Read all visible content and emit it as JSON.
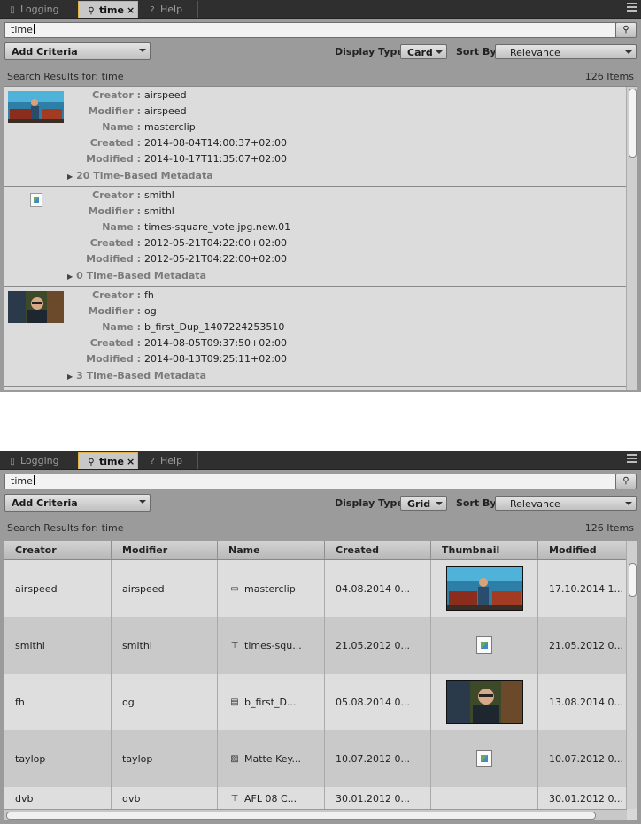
{
  "tabs": [
    {
      "label": "Logging",
      "icon": "document-icon"
    },
    {
      "label": "time",
      "icon": "search-icon",
      "close": "×"
    },
    {
      "label": "Help",
      "icon": "help-icon"
    }
  ],
  "search": {
    "value": "time"
  },
  "criteria": {
    "add_label": "Add Criteria"
  },
  "display_type_label": "Display Type:",
  "sort_by_label": "Sort By:",
  "sort_by_value": "Relevance",
  "results_label": "Search Results for: time",
  "results_count": "126 Items",
  "card_view": {
    "display_type_value": "Card",
    "labels": {
      "creator": "Creator :",
      "modifier": "Modifier :",
      "name": "Name :",
      "created": "Created :",
      "modified": "Modified :"
    },
    "items": [
      {
        "creator": "airspeed",
        "modifier": "airspeed",
        "name": "masterclip",
        "created": "2014-08-04T14:00:37+02:00",
        "modified": "2014-10-17T11:35:07+02:00",
        "metadata": "20 Time-Based Metadata",
        "thumb": "image"
      },
      {
        "creator": "smithl",
        "modifier": "smithl",
        "name": "times-square_vote.jpg.new.01",
        "created": "2012-05-21T04:22:00+02:00",
        "modified": "2012-05-21T04:22:00+02:00",
        "metadata": "0 Time-Based Metadata",
        "thumb": "broken"
      },
      {
        "creator": "fh",
        "modifier": "og",
        "name": "b_first_Dup_1407224253510",
        "created": "2014-08-05T09:37:50+02:00",
        "modified": "2014-08-13T09:25:11+02:00",
        "metadata": "3 Time-Based Metadata",
        "thumb": "image"
      }
    ]
  },
  "grid_view": {
    "display_type_value": "Grid",
    "columns": [
      "Creator",
      "Modifier",
      "Name",
      "Created",
      "Thumbnail",
      "Modified"
    ],
    "rows": [
      {
        "creator": "airspeed",
        "modifier": "airspeed",
        "name": "masterclip",
        "name_icon": "clip-icon",
        "created": "04.08.2014 0...",
        "thumb": "image",
        "modified": "17.10.2014 1..."
      },
      {
        "creator": "smithl",
        "modifier": "smithl",
        "name": "times-squ...",
        "name_icon": "graphic-icon",
        "created": "21.05.2012 0...",
        "thumb": "broken",
        "modified": "21.05.2012 0..."
      },
      {
        "creator": "fh",
        "modifier": "og",
        "name": "b_first_D...",
        "name_icon": "sequence-icon",
        "created": "05.08.2014 0...",
        "thumb": "image",
        "modified": "13.08.2014 0..."
      },
      {
        "creator": "taylop",
        "modifier": "taylop",
        "name": "Matte Key...",
        "name_icon": "matte-icon",
        "created": "10.07.2012 0...",
        "thumb": "broken",
        "modified": "10.07.2012 0..."
      },
      {
        "creator": "dvb",
        "modifier": "dvb",
        "name": "AFL 08 C...",
        "name_icon": "graphic-icon",
        "created": "30.01.2012 0...",
        "thumb": "none",
        "modified": "30.01.2012 0..."
      }
    ]
  }
}
